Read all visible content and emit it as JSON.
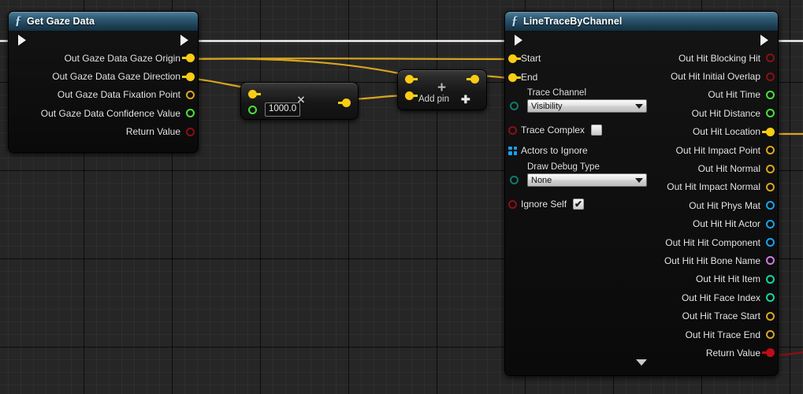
{
  "editor": {
    "name": "unreal-blueprint-graph",
    "background_color": "#262626",
    "grid_minor_color": "#2f2f2f",
    "grid_major_color": "#000000"
  },
  "pin_colors": {
    "exec": "#f2f2f2",
    "vector": "#facc15",
    "float": "#4ade3a",
    "boolean": "#8b0f16",
    "object": "#1ba0e8",
    "name": "#cf7ae0",
    "integer": "#12d6a0",
    "enum": "#0f7a6e",
    "array_object": "#1ba0e8",
    "wire_data": "#d9a520",
    "wire_exec": "#f2f2f2",
    "wire_bool": "#8b0f16"
  },
  "nodes": {
    "get_gaze_data": {
      "title": "Get Gaze Data",
      "fn_glyph": "ƒ",
      "outputs": [
        {
          "label": "Out Gaze Data Gaze Origin",
          "type": "vector",
          "connected": true
        },
        {
          "label": "Out Gaze Data Gaze Direction",
          "type": "vector",
          "connected": true
        },
        {
          "label": "Out Gaze Data Fixation Point",
          "type": "vector",
          "connected": false
        },
        {
          "label": "Out Gaze Data Confidence Value",
          "type": "float",
          "connected": false
        },
        {
          "label": "Return Value",
          "type": "boolean",
          "connected": false
        }
      ]
    },
    "multiply": {
      "op_symbol": "×",
      "value": "1000.0",
      "inputs": [
        {
          "type": "vector",
          "connected": true
        },
        {
          "type": "float",
          "connected": false
        }
      ],
      "outputs": [
        {
          "type": "vector",
          "connected": true
        }
      ]
    },
    "add": {
      "op_symbol": "+",
      "add_pin_label": "Add pin",
      "add_pin_glyph": "➕",
      "inputs": [
        {
          "type": "vector",
          "connected": true
        },
        {
          "type": "vector",
          "connected": true
        }
      ],
      "outputs": [
        {
          "type": "vector",
          "connected": true
        }
      ]
    },
    "line_trace_by_channel": {
      "title": "LineTraceByChannel",
      "fn_glyph": "ƒ",
      "inputs": [
        {
          "label": "Start",
          "type": "vector",
          "connected": true,
          "widget": "none"
        },
        {
          "label": "End",
          "type": "vector",
          "connected": true,
          "widget": "none"
        },
        {
          "label": "Trace Channel",
          "type": "enum",
          "connected": false,
          "widget": "combo",
          "value": "Visibility"
        },
        {
          "label": "Trace Complex",
          "type": "boolean",
          "connected": false,
          "widget": "checkbox",
          "checked": false
        },
        {
          "label": "Actors to Ignore",
          "type": "array_object",
          "connected": false,
          "widget": "none"
        },
        {
          "label": "Draw Debug Type",
          "type": "enum",
          "connected": false,
          "widget": "combo",
          "value": "None"
        },
        {
          "label": "Ignore Self",
          "type": "boolean",
          "connected": false,
          "widget": "checkbox",
          "checked": true
        }
      ],
      "outputs": [
        {
          "label": "Out Hit Blocking Hit",
          "type": "boolean",
          "connected": false
        },
        {
          "label": "Out Hit Initial Overlap",
          "type": "boolean",
          "connected": false
        },
        {
          "label": "Out Hit Time",
          "type": "float",
          "connected": false
        },
        {
          "label": "Out Hit Distance",
          "type": "float",
          "connected": false
        },
        {
          "label": "Out Hit Location",
          "type": "vector",
          "connected": true
        },
        {
          "label": "Out Hit Impact Point",
          "type": "vector",
          "connected": false
        },
        {
          "label": "Out Hit Normal",
          "type": "vector",
          "connected": false
        },
        {
          "label": "Out Hit Impact Normal",
          "type": "vector",
          "connected": false
        },
        {
          "label": "Out Hit Phys Mat",
          "type": "object",
          "connected": false
        },
        {
          "label": "Out Hit Hit Actor",
          "type": "object",
          "connected": false
        },
        {
          "label": "Out Hit Hit Component",
          "type": "object",
          "connected": false
        },
        {
          "label": "Out Hit Hit Bone Name",
          "type": "name",
          "connected": false
        },
        {
          "label": "Out Hit Hit Item",
          "type": "integer",
          "connected": false
        },
        {
          "label": "Out Hit Face Index",
          "type": "integer",
          "connected": false
        },
        {
          "label": "Out Hit Trace Start",
          "type": "vector",
          "connected": false
        },
        {
          "label": "Out Hit Trace End",
          "type": "vector",
          "connected": false
        },
        {
          "label": "Return Value",
          "type": "boolean",
          "connected": true
        }
      ]
    }
  }
}
